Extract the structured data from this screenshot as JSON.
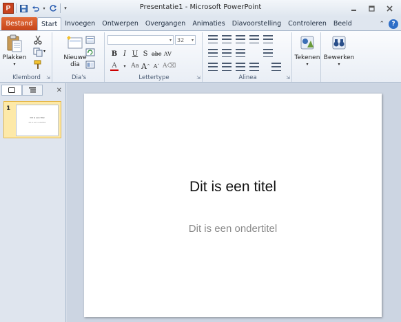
{
  "window": {
    "title": "Presentatie1 - Microsoft PowerPoint",
    "app_icon_letter": "P",
    "controls": [
      "minimize",
      "maximize",
      "close"
    ]
  },
  "quick_access": [
    "save-icon",
    "undo-icon",
    "redo-icon",
    "customize-icon"
  ],
  "ribbon_tabs": {
    "file": "Bestand",
    "tabs": [
      "Start",
      "Invoegen",
      "Ontwerpen",
      "Overgangen",
      "Animaties",
      "Diavoorstelling",
      "Controleren",
      "Beeld"
    ],
    "active": "Start"
  },
  "groups": {
    "clipboard": {
      "label": "Klembord",
      "paste": "Plakken"
    },
    "slides": {
      "label": "Dia's",
      "new_slide_line1": "Nieuwe",
      "new_slide_line2": "dia"
    },
    "font": {
      "label": "Lettertype",
      "font_name": "",
      "font_size": "32"
    },
    "paragraph": {
      "label": "Alinea"
    },
    "drawing": {
      "label": "",
      "draw": "Tekenen"
    },
    "editing": {
      "label": "",
      "edit": "Bewerken"
    }
  },
  "format_buttons": [
    "B",
    "I",
    "U",
    "S",
    "abc",
    "AV"
  ],
  "slide_pane": {
    "tabs": [
      "slides-tab",
      "outline-tab"
    ],
    "thumbnail_number": "1"
  },
  "slide": {
    "title": "Dit is een titel",
    "subtitle": "Dit is een ondertitel"
  },
  "colors": {
    "file_tab": "#c6451a",
    "thumbnail_highlight": "#fde9a8",
    "subtitle": "#8a8a8a"
  }
}
